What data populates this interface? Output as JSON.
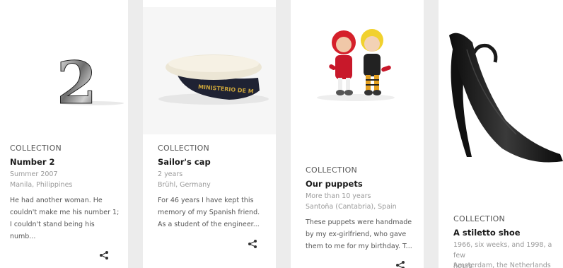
{
  "cards": [
    {
      "label": "COLLECTION",
      "title": "Number 2",
      "meta1": "Summer 2007",
      "meta2": "Manila, Philippines",
      "desc": [
        "He had another woman. He",
        "couldn't make me his number 1;",
        "I couldn't stand being his",
        "numb..."
      ],
      "image_icon": "number-two-sculpture",
      "share_icon": "share-icon"
    },
    {
      "label": "COLLECTION",
      "title": "Sailor's cap",
      "meta1": "2 years",
      "meta2": "Brühl, Germany",
      "desc": [
        "For 46 years I have kept this",
        "memory of my Spanish friend.",
        "As a student of the engineer..."
      ],
      "cap_text": "MINISTERIO DE M",
      "image_icon": "sailor-cap",
      "share_icon": "share-icon"
    },
    {
      "label": "COLLECTION",
      "title": "Our puppets",
      "meta1": "More than 10 years",
      "meta2": "Santoña (Cantabria), Spain",
      "desc": [
        "These puppets were handmade",
        "by my ex-girlfriend, who gave",
        "them to me for my birthday. T..."
      ],
      "image_icon": "puppets",
      "share_icon": "share-icon"
    },
    {
      "label": "COLLECTION",
      "title": "A stiletto shoe",
      "meta1": "1966, six weeks, and 1998, a few",
      "meta1b": "hours",
      "meta2": "Amsterdam, the Netherlands",
      "image_icon": "stiletto-shoe"
    }
  ]
}
